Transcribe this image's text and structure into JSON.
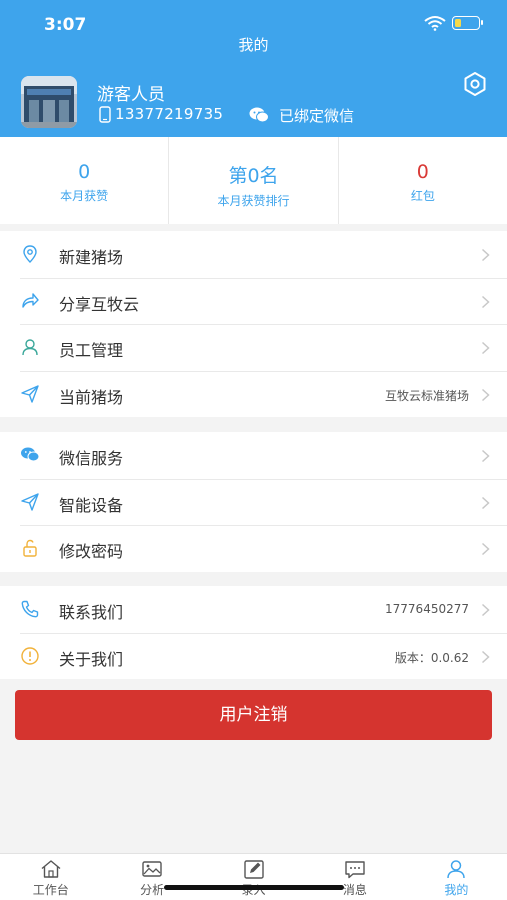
{
  "status_bar": {
    "time": "3:07"
  },
  "header": {
    "title": "我的",
    "user_name": "游客人员",
    "phone": "13377219735",
    "wechat_status": "已绑定微信"
  },
  "stats": [
    {
      "value": "0",
      "label": "本月获赞"
    },
    {
      "value": "第0名",
      "label": "本月获赞排行"
    },
    {
      "value": "0",
      "label": "红包"
    }
  ],
  "menu_group_1": [
    {
      "label": "新建猪场",
      "icon": "location-icon"
    },
    {
      "label": "分享互牧云",
      "icon": "share-icon"
    },
    {
      "label": "员工管理",
      "icon": "person-icon"
    },
    {
      "label": "当前猪场",
      "icon": "send-icon",
      "value": "互牧云标准猪场"
    }
  ],
  "menu_group_2": [
    {
      "label": "微信服务",
      "icon": "wechat-icon"
    },
    {
      "label": "智能设备",
      "icon": "send-icon"
    },
    {
      "label": "修改密码",
      "icon": "unlock-icon"
    }
  ],
  "menu_group_3": [
    {
      "label": "联系我们",
      "icon": "phone-icon",
      "value": "17776450277"
    },
    {
      "label": "关于我们",
      "icon": "info-icon",
      "value": "版本：0.0.62"
    }
  ],
  "logout_button": "用户注销",
  "tabbar": [
    {
      "label": "工作台",
      "icon": "home-icon"
    },
    {
      "label": "分析",
      "icon": "image-icon"
    },
    {
      "label": "录入",
      "icon": "edit-icon"
    },
    {
      "label": "消息",
      "icon": "message-icon"
    },
    {
      "label": "我的",
      "icon": "profile-icon",
      "active": true
    }
  ],
  "colors": {
    "primary": "#3ea4ec",
    "danger": "#d5342f",
    "badge_red": "#d93a36"
  }
}
